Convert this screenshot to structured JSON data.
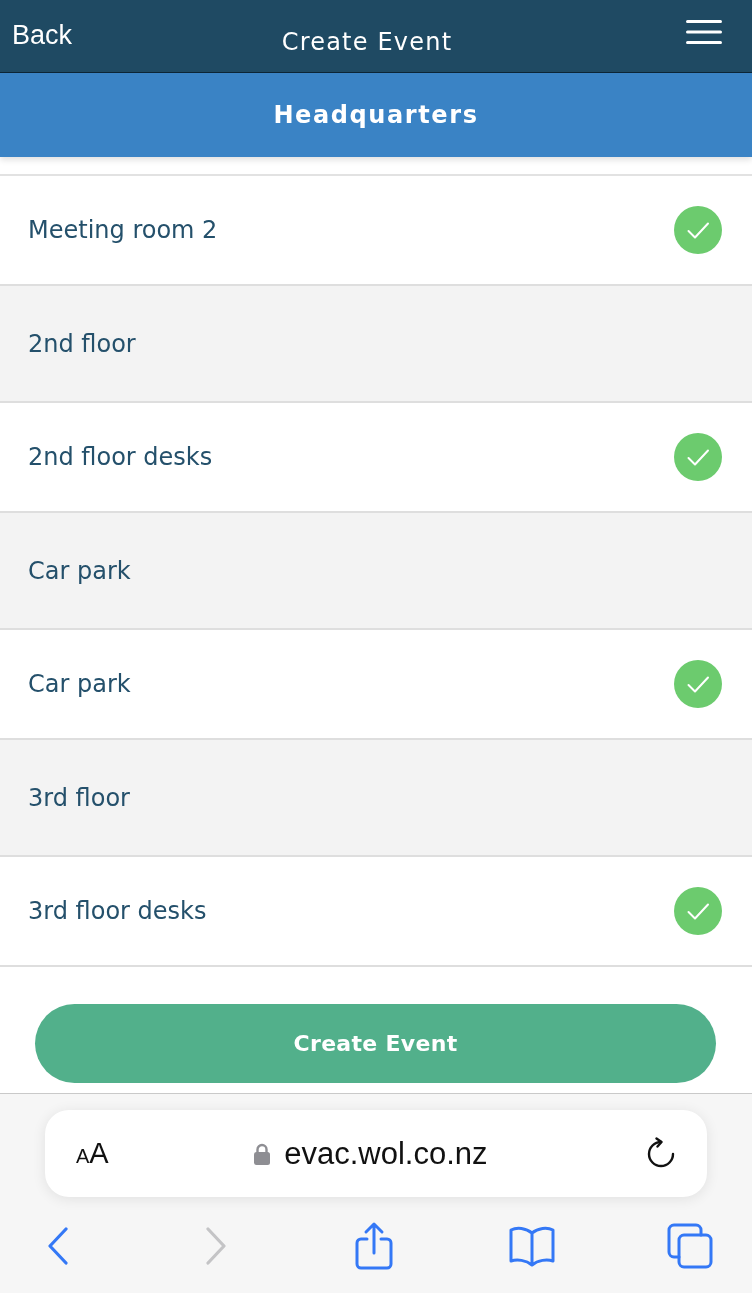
{
  "header": {
    "back_label": "Back",
    "title": "Create Event"
  },
  "site_bar": {
    "title": "Headquarters"
  },
  "locations": [
    {
      "kind": "location",
      "label": "Meeting room 2",
      "checked": true
    },
    {
      "kind": "heading",
      "label": "2nd floor"
    },
    {
      "kind": "location",
      "label": "2nd floor desks",
      "checked": true
    },
    {
      "kind": "heading",
      "label": "Car park"
    },
    {
      "kind": "location",
      "label": "Car park",
      "checked": true
    },
    {
      "kind": "heading",
      "label": "3rd floor"
    },
    {
      "kind": "location",
      "label": "3rd floor desks",
      "checked": true
    }
  ],
  "create_button": {
    "label": "Create Event"
  },
  "browser": {
    "text_size_label": "AA",
    "url": "evac.wol.co.nz",
    "toolbar": [
      {
        "kind": "back",
        "disabled": false
      },
      {
        "kind": "forward",
        "disabled": true
      },
      {
        "kind": "share",
        "disabled": false
      },
      {
        "kind": "bookmarks",
        "disabled": false
      },
      {
        "kind": "tabs",
        "disabled": false
      }
    ]
  }
}
